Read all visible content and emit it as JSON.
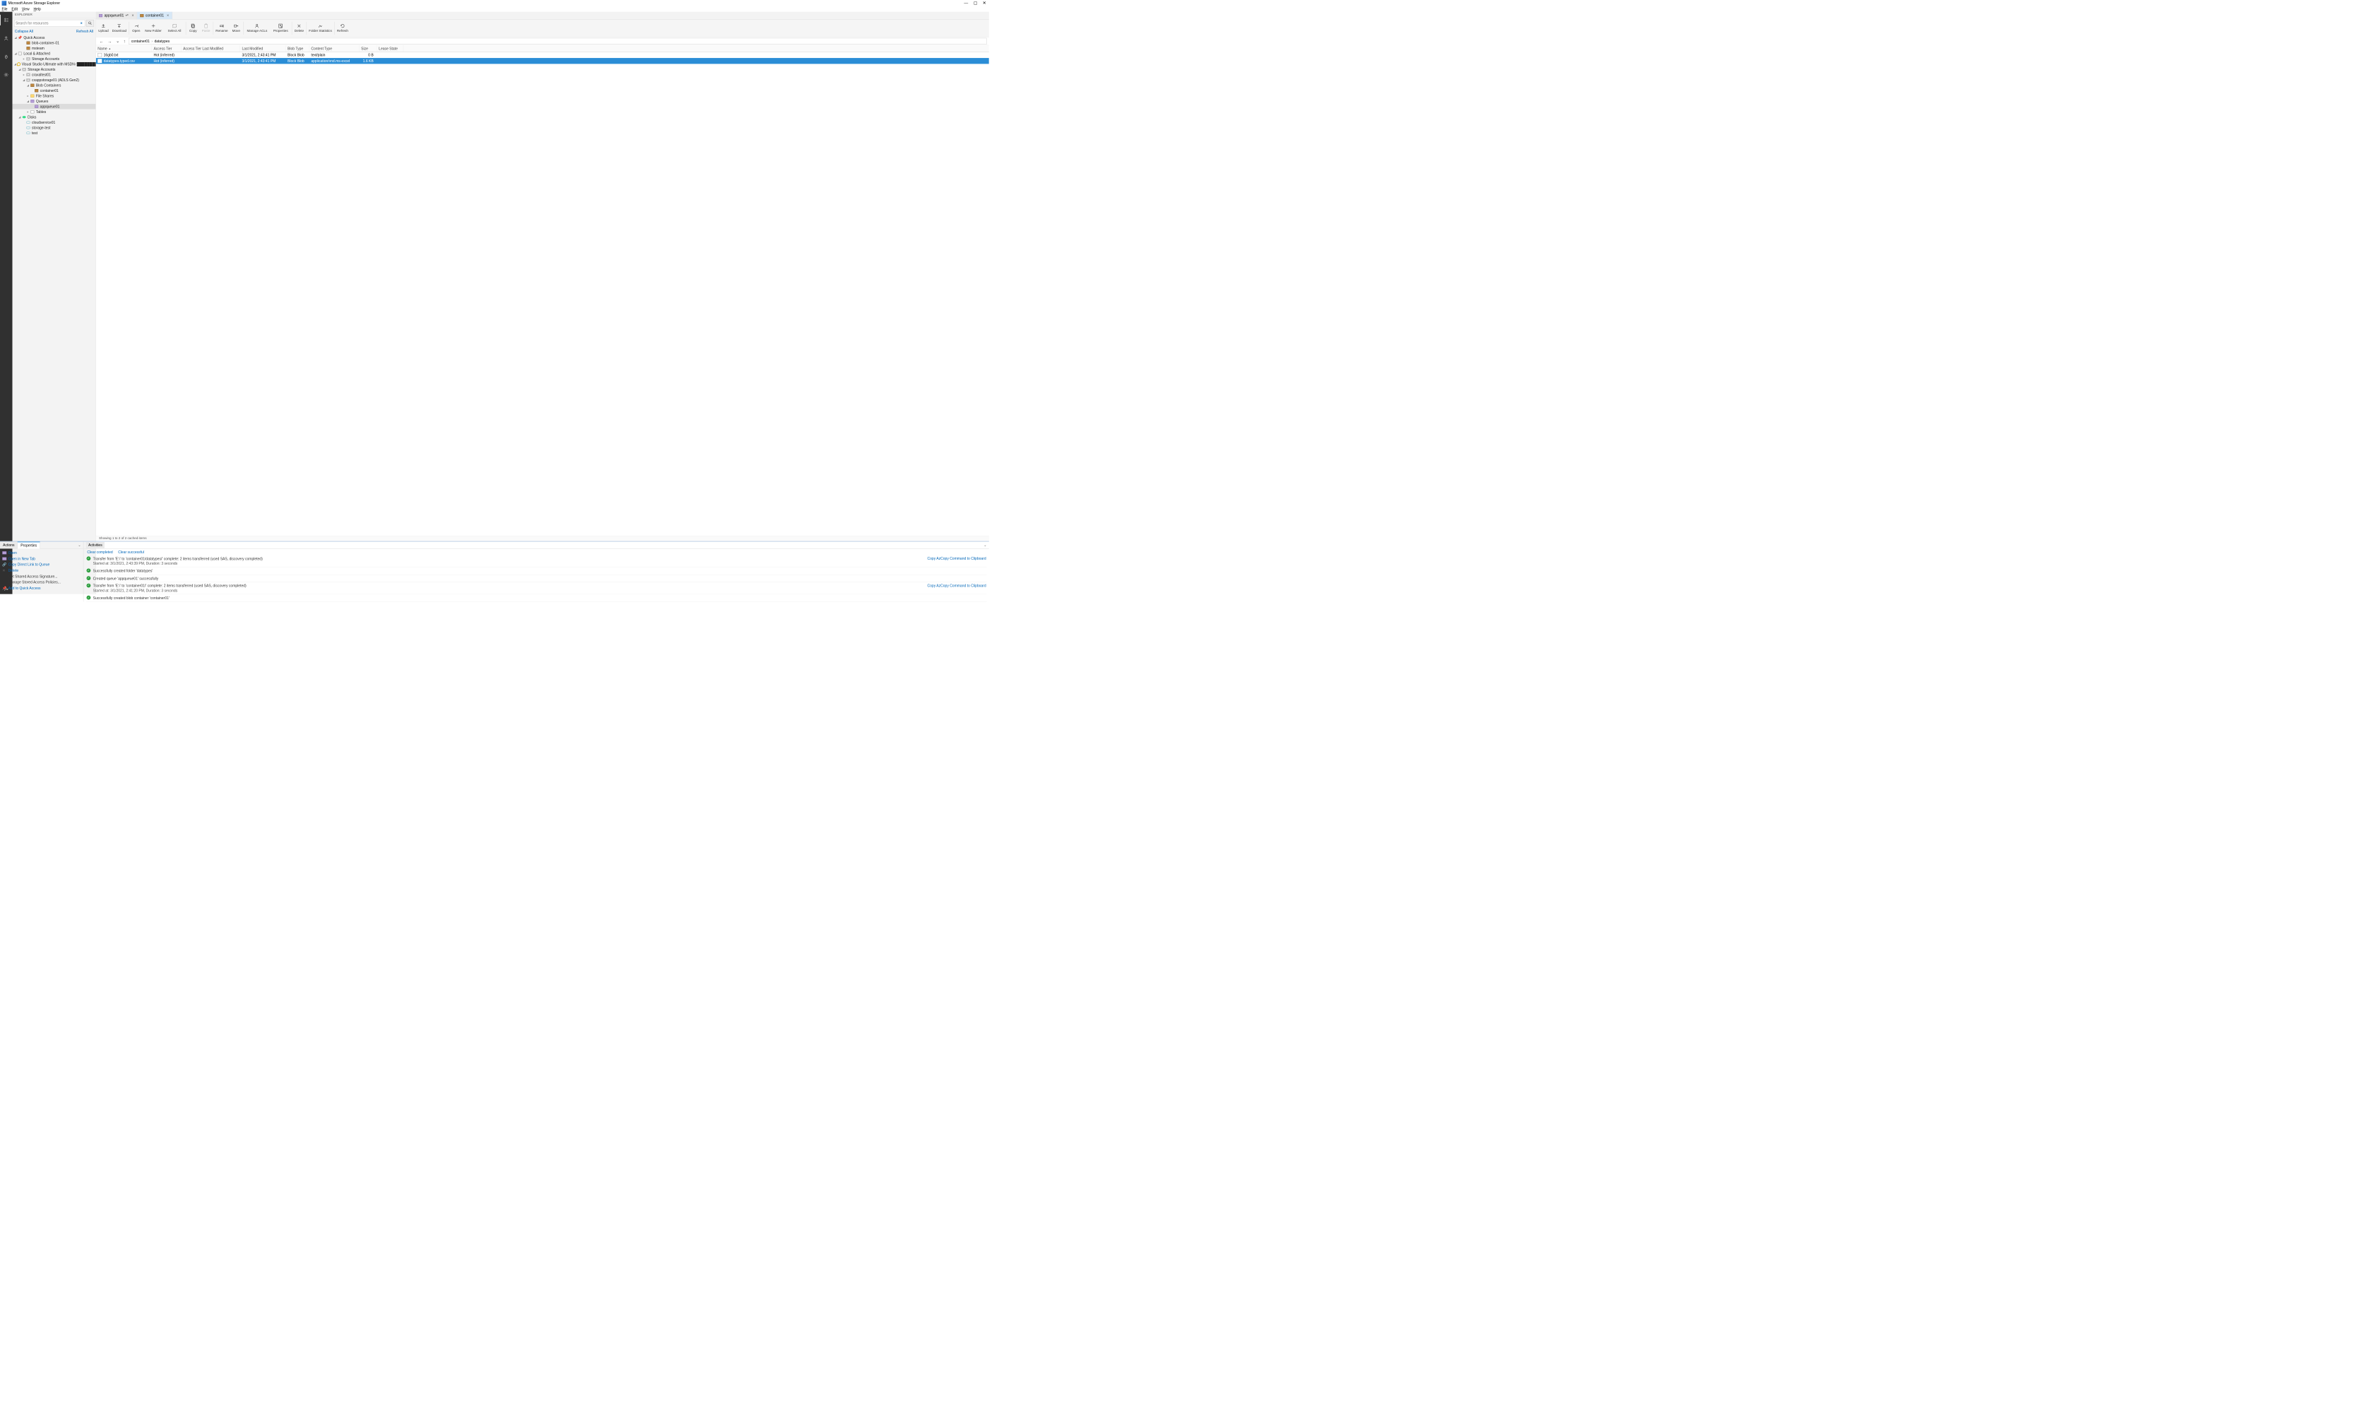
{
  "window": {
    "title": "Microsoft Azure Storage Explorer"
  },
  "menubar": [
    "File",
    "Edit",
    "View",
    "Help"
  ],
  "explorer": {
    "header": "EXPLORER",
    "search_placeholder": "Search for resources",
    "collapse_all": "Collapse All",
    "refresh_all": "Refresh All",
    "quick_access": "Quick Access",
    "quick_items": [
      "blob-container-01",
      "msteam"
    ],
    "local_attached": "Local & Attached",
    "storage_accounts": "Storage Accounts",
    "subscription": "Visual Studio Ultimate with MSDN (",
    "sub_storage_accounts": "Storage Accounts",
    "account1": "craxaltest01",
    "account2": "cxappstorage01 (ADLS Gen2)",
    "blob_containers": "Blob Containers",
    "container01": "container01",
    "file_shares": "File Shares",
    "queues": "Queues",
    "appqueue01": "appqueue01",
    "tables": "Tables",
    "disks": "Disks",
    "disk_items": [
      "cloudservice01",
      "storage-test",
      "test"
    ]
  },
  "tabs": [
    {
      "key": "appqueue01",
      "label": "appqueue01",
      "dirty": true,
      "active": false
    },
    {
      "key": "container01",
      "label": "container01",
      "dirty": false,
      "active": true
    }
  ],
  "toolbar": {
    "upload": "Upload",
    "download": "Download",
    "open": "Open",
    "new_folder": "New Folder",
    "select_all": "Select All",
    "copy": "Copy",
    "paste": "Paste",
    "rename": "Rename",
    "move": "Move",
    "manage_acls": "Manage ACLs",
    "properties": "Properties",
    "delete": "Delete",
    "folder_stats": "Folder Statistics",
    "refresh": "Refresh"
  },
  "breadcrumb": {
    "c0": "container01",
    "c1": "datatypes"
  },
  "table": {
    "headers": {
      "name": "Name",
      "tier": "Access Tier",
      "tier_mod": "Access Tier Last Modified",
      "last_mod": "Last Modified",
      "blob_type": "Blob Type",
      "content_type": "Content Type",
      "size": "Size",
      "lease": "Lease State"
    },
    "rows": [
      {
        "name": "16gb0.txt",
        "tier": "Hot (inferred)",
        "tier_mod": "",
        "last_mod": "3/1/2021, 2:43:41 PM",
        "blob_type": "Block Blob",
        "content_type": "text/plain",
        "size": "0 B",
        "lease": "",
        "selected": false
      },
      {
        "name": "datatypes.typed.csv",
        "tier": "Hot (inferred)",
        "tier_mod": "",
        "last_mod": "3/1/2021, 2:43:41 PM",
        "blob_type": "Block Blob",
        "content_type": "application/vnd.ms-excel",
        "size": "1.6 KB",
        "lease": "",
        "selected": true
      }
    ],
    "status": "Showing 1 to 2 of 2 cached items"
  },
  "bottom_left": {
    "tab_actions": "Actions",
    "tab_properties": "Properties",
    "items": [
      {
        "label": "Open"
      },
      {
        "label": "Open in New Tab"
      },
      {
        "label": "Copy Direct Link to Queue"
      },
      {
        "label": "Delete"
      },
      {
        "label": "Get Shared Access Signature..."
      },
      {
        "label": "Manage Stored Access Policies..."
      },
      {
        "label": "Add to Quick Access"
      }
    ]
  },
  "activities": {
    "tab": "Activities",
    "clear_completed": "Clear completed",
    "clear_successful": "Clear successful",
    "copy_link": "Copy AzCopy Command to Clipboard",
    "list": [
      {
        "line1": "Transfer from 'E:\\' to 'container01/datatypes/' complete: 2 items transferred (used SAS, discovery completed)",
        "line2": "Started at: 3/1/2021, 2:43:39 PM, Duration: 3 seconds",
        "copy": true
      },
      {
        "line1": "Successfully created folder 'datatypes'",
        "line2": "",
        "copy": false
      },
      {
        "line1": "Created queue 'appqueue01' successfully",
        "line2": "",
        "copy": false
      },
      {
        "line1": "Transfer from 'E:\\' to 'container01/' complete: 2 items transferred (used SAS, discovery completed)",
        "line2": "Started at: 3/1/2021, 2:41:20 PM, Duration: 3 seconds",
        "copy": true
      },
      {
        "line1": "Successfully created blob container 'container01'",
        "line2": "",
        "copy": false
      }
    ]
  },
  "colors": {
    "accent": "#0066b8",
    "selection": "#2a8dd6"
  }
}
